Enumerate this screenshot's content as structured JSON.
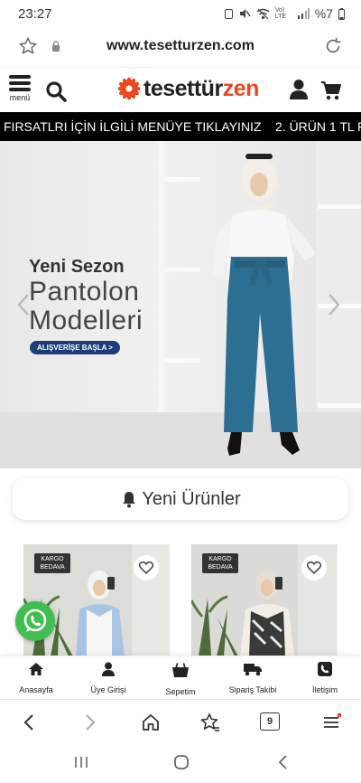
{
  "status_bar": {
    "time": "23:27",
    "network": "Vo) LTE",
    "battery": "%7"
  },
  "browser": {
    "url": "www.tesetturzen.com"
  },
  "header": {
    "menu_label": "menü",
    "logo_main": "tesettür",
    "logo_accent": "zen"
  },
  "ticker": {
    "text_1": "FIRSATLRI İÇİN İLGİLİ MENÜYE TIKLAYINIZ",
    "text_2": "2. ÜRÜN 1 TL FI"
  },
  "banner": {
    "line_1": "Yeni Sezon",
    "line_2": "Pantolon",
    "line_3": "Modelleri",
    "cta": "ALIŞVERİŞE BAŞLA >"
  },
  "section": {
    "title": "Yeni Ürünler"
  },
  "products": [
    {
      "badge_line_1": "KARGO",
      "badge_line_2": "BEDAVA"
    },
    {
      "badge_line_1": "KARGO",
      "badge_line_2": "BEDAVA"
    }
  ],
  "site_nav": [
    {
      "label": "Anasayfa",
      "icon": "home-icon"
    },
    {
      "label": "Üye Girişi",
      "icon": "user-icon"
    },
    {
      "label": "Sepetim",
      "icon": "bag-icon"
    },
    {
      "label": "Sipariş Takibi",
      "icon": "truck-icon"
    },
    {
      "label": "İletişim",
      "icon": "phone-icon"
    }
  ],
  "browser_nav": {
    "tab_count": "9"
  },
  "colors": {
    "brand_orange": "#e8491d",
    "ticker_bg": "#000000",
    "cta_blue": "#1f3c7a",
    "whatsapp_green": "#3fbf52"
  }
}
